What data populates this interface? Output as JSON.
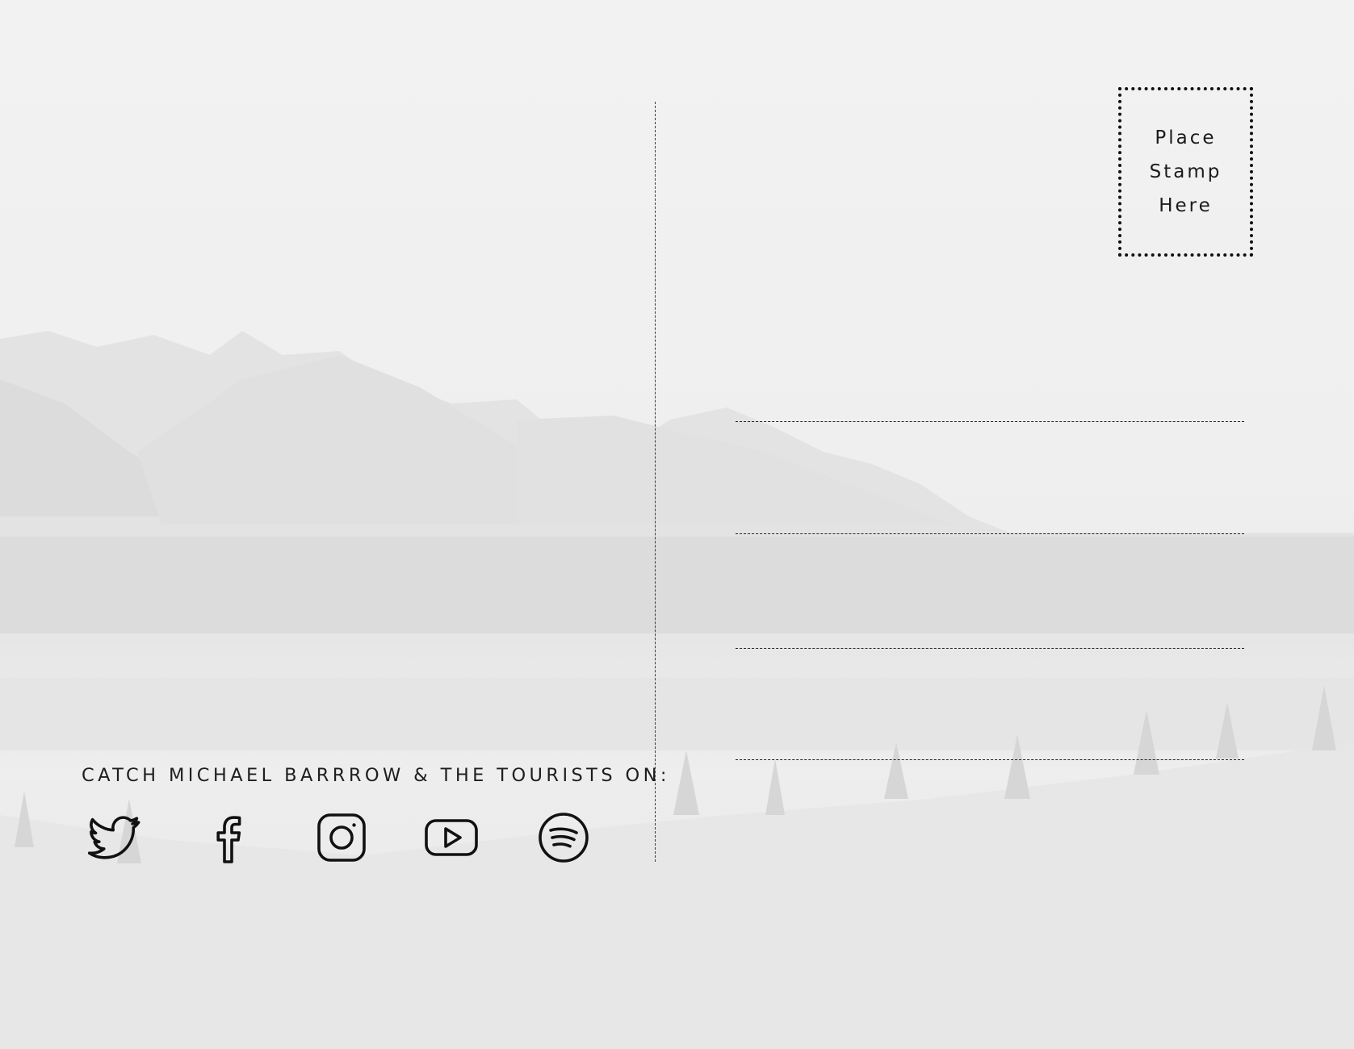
{
  "background": {
    "description_icon": "mountain-lake-landscape-photo",
    "tone": "#efefef"
  },
  "stamp": {
    "line1": "Place",
    "line2": "Stamp",
    "line3": "Here"
  },
  "address_lines_count": 4,
  "promo": {
    "text": "CATCH MICHAEL BARRROW & THE TOURISTS ON:"
  },
  "social_icons": [
    "twitter-icon",
    "facebook-icon",
    "instagram-icon",
    "youtube-icon",
    "spotify-icon"
  ],
  "colors": {
    "ink": "#111111",
    "paper": "#f3f3f3"
  }
}
